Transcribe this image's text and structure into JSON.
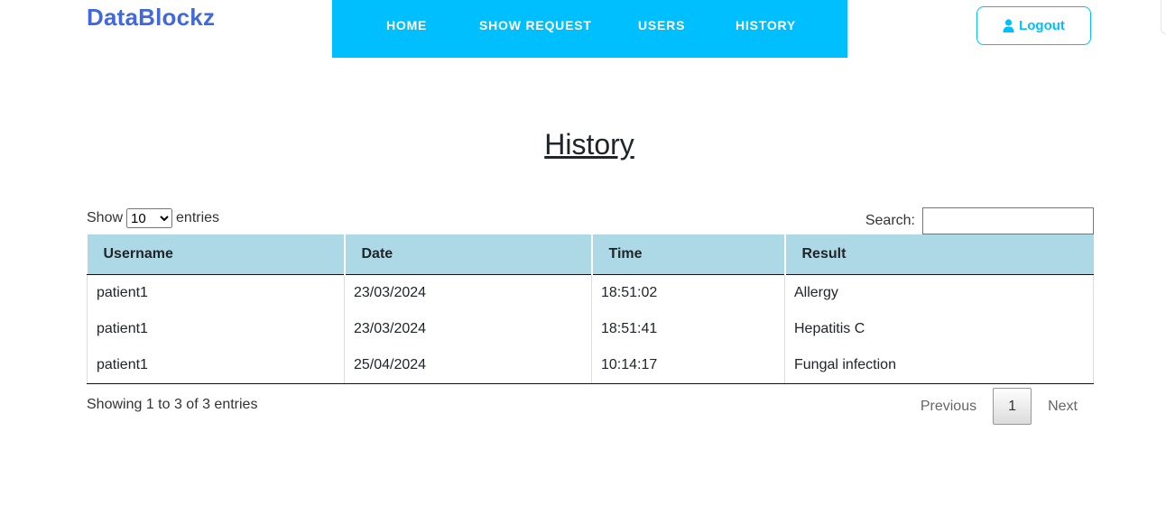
{
  "brand": "DataBlockz",
  "nav": {
    "home": "HOME",
    "show_request": "SHOW REQUEST",
    "users": "USERS",
    "history": "HISTORY"
  },
  "logout": {
    "label": "Logout",
    "icon": "user-icon"
  },
  "page_title": "History",
  "table_controls": {
    "show_label": "Show",
    "entries_label": "entries",
    "page_length": "10",
    "search_label": "Search:",
    "search_value": ""
  },
  "table": {
    "headers": [
      "Username",
      "Date",
      "Time",
      "Result"
    ],
    "rows": [
      [
        "patient1",
        "23/03/2024",
        "18:51:02",
        "Allergy"
      ],
      [
        "patient1",
        "23/03/2024",
        "18:51:41",
        "Hepatitis C"
      ],
      [
        "patient1",
        "25/04/2024",
        "10:14:17",
        "Fungal infection"
      ]
    ]
  },
  "footer": {
    "info": "Showing 1 to 3 of 3 entries",
    "previous": "Previous",
    "page": "1",
    "next": "Next"
  },
  "colors": {
    "brand": "#4169d9",
    "nav_bg": "#00bfff",
    "header_bg": "#add8e6"
  }
}
